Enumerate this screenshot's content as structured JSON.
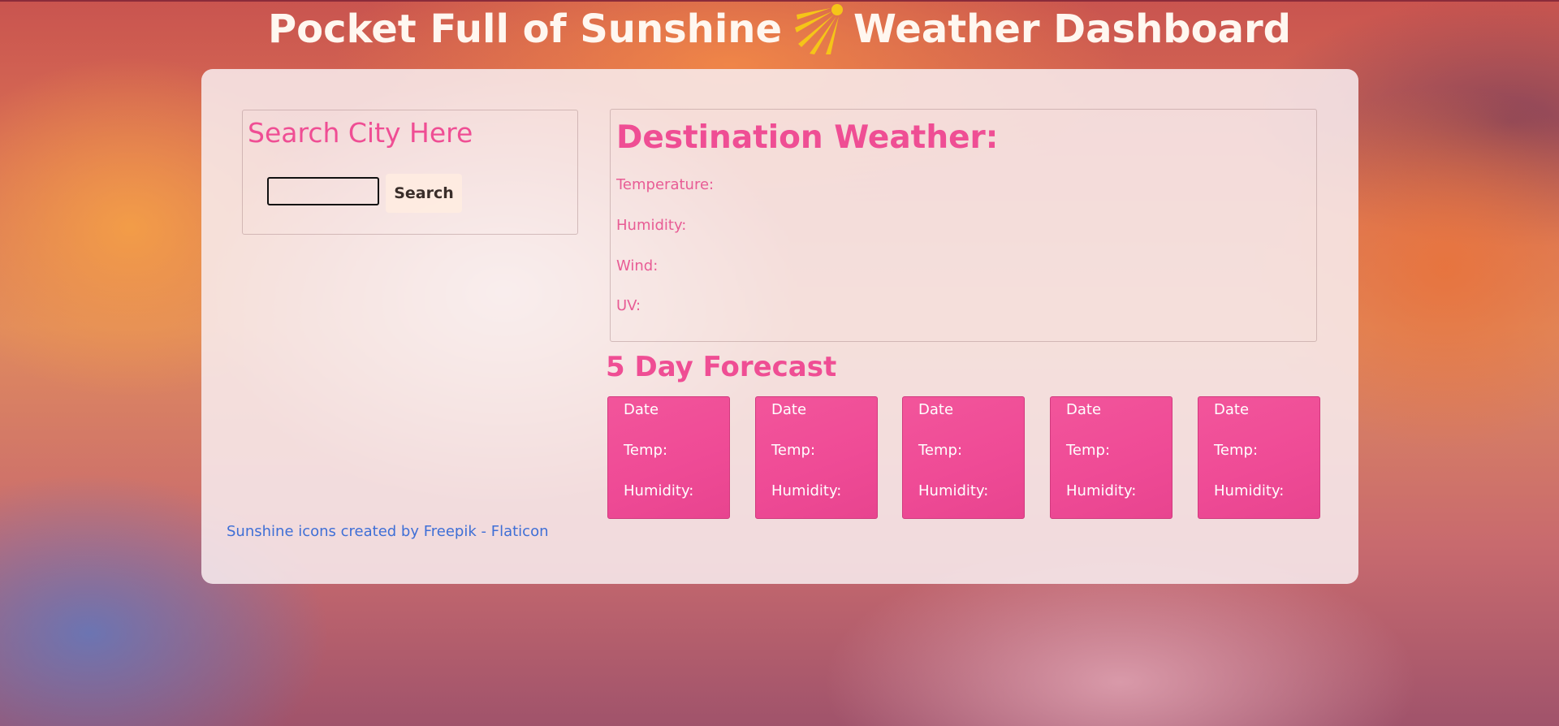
{
  "header": {
    "title_left": "Pocket Full of Sunshine",
    "title_right": "Weather Dashboard",
    "icon": "sunshine-icon",
    "icon_color": "#f5c518"
  },
  "search": {
    "heading": "Search City Here",
    "input_value": "",
    "button_label": "Search"
  },
  "current": {
    "heading": "Destination Weather:",
    "temperature_label": "Temperature:",
    "humidity_label": "Humidity:",
    "wind_label": "Wind:",
    "uv_label": "UV:"
  },
  "forecast": {
    "heading": "5 Day Forecast",
    "cards": [
      {
        "date": "Date",
        "temp": "Temp:",
        "humidity": "Humidity:"
      },
      {
        "date": "Date",
        "temp": "Temp:",
        "humidity": "Humidity:"
      },
      {
        "date": "Date",
        "temp": "Temp:",
        "humidity": "Humidity:"
      },
      {
        "date": "Date",
        "temp": "Temp:",
        "humidity": "Humidity:"
      },
      {
        "date": "Date",
        "temp": "Temp:",
        "humidity": "Humidity:"
      }
    ]
  },
  "footer": {
    "credit": "Sunshine icons created by Freepik - Flaticon"
  },
  "colors": {
    "accent_pink": "#ef4e94",
    "card_pink": "#ef4b96",
    "link_blue": "#3f6fd6",
    "title_text": "#fff7f0"
  }
}
